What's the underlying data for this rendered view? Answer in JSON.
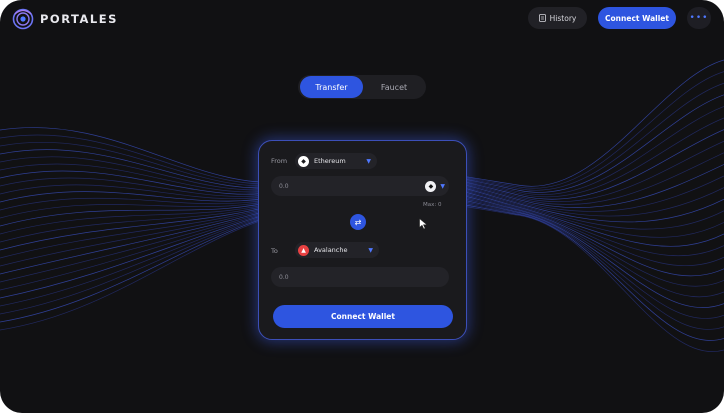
{
  "brand": {
    "name": "PORTALES"
  },
  "header": {
    "history_label": "History",
    "connect_label": "Connect Wallet",
    "more_label": "•••"
  },
  "tabs": [
    {
      "label": "Transfer",
      "active": true
    },
    {
      "label": "Faucet",
      "active": false
    }
  ],
  "bridge": {
    "from_label": "From",
    "from_chain": "Ethereum",
    "from_amount": "0.0",
    "max_label": "Max: 0",
    "to_label": "To",
    "to_chain": "Avalanche",
    "to_amount": "0.0",
    "connect_label": "Connect Wallet"
  },
  "colors": {
    "background": "#111113",
    "accent": "#2e55e0",
    "card": "#1a1a1d",
    "ethereum_icon": "#ffffff",
    "avalanche_icon": "#e84142"
  },
  "icons": {
    "logo": "portal-logo-icon",
    "history": "document-icon",
    "swap": "swap-arrows-icon",
    "token": "ethereum-icon",
    "dropdown": "chevron-down-icon"
  }
}
